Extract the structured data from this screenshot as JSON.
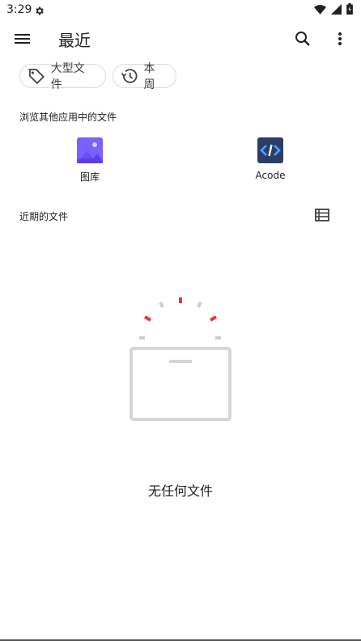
{
  "status": {
    "time": "3:29"
  },
  "header": {
    "title": "最近"
  },
  "chips": [
    {
      "label": "大型文件",
      "icon": "label-tag-icon"
    },
    {
      "label": "本周",
      "icon": "history-clock-icon"
    }
  ],
  "browse": {
    "heading": "浏览其他应用中的文件",
    "apps": [
      {
        "name": "图库",
        "icon": "gallery-image-icon",
        "color": "#7b61ff"
      },
      {
        "name": "Acode",
        "icon": "acode-code-icon",
        "color": "#2c3e66"
      }
    ]
  },
  "recent": {
    "heading": "近期的文件"
  },
  "empty_state": {
    "message": "无任何文件"
  },
  "colors": {
    "accent_red": "#e53935",
    "divider": "#dadce0"
  }
}
